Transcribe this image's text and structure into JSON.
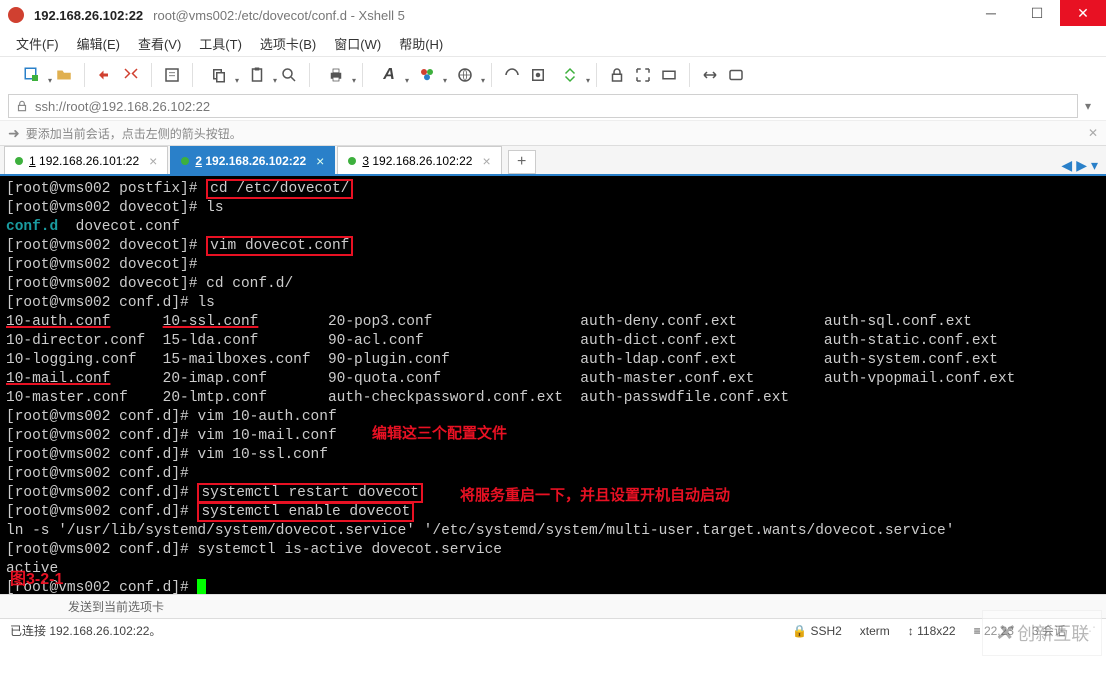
{
  "title": {
    "ip": "192.168.26.102:22",
    "path": "root@vms002:/etc/dovecot/conf.d - Xshell 5"
  },
  "menu": {
    "file": "文件(F)",
    "edit": "编辑(E)",
    "view": "查看(V)",
    "tools": "工具(T)",
    "tabs": "选项卡(B)",
    "window": "窗口(W)",
    "help": "帮助(H)"
  },
  "address": "ssh://root@192.168.26.102:22",
  "hint": "要添加当前会话，点击左侧的箭头按钮。",
  "tabs": [
    {
      "index": "1",
      "label": "192.168.26.101:22"
    },
    {
      "index": "2",
      "label": "192.168.26.102:22"
    },
    {
      "index": "3",
      "label": "192.168.26.102:22"
    }
  ],
  "active_tab": 1,
  "term": {
    "prompt_postfix": "[root@vms002 postfix]# ",
    "prompt_dovecot": "[root@vms002 dovecot]# ",
    "prompt_confd": "[root@vms002 conf.d]# ",
    "cmd_cd": "cd /etc/dovecot/",
    "cmd_ls": "ls",
    "ls1_confd": "conf.d",
    "ls1_file": "  dovecot.conf",
    "cmd_vim_dove": "vim dovecot.conf",
    "cmd_cd_confd": "cd conf.d/",
    "files_col1": [
      "10-auth.conf",
      "10-director.conf",
      "10-logging.conf",
      "10-mail.conf",
      "10-master.conf"
    ],
    "files_col2": [
      "10-ssl.conf",
      "15-lda.conf",
      "15-mailboxes.conf",
      "20-imap.conf",
      "20-lmtp.conf"
    ],
    "files_col3": [
      "20-pop3.conf",
      "90-acl.conf",
      "90-plugin.conf",
      "90-quota.conf",
      "auth-checkpassword.conf.ext"
    ],
    "files_col4": [
      "auth-deny.conf.ext",
      "auth-dict.conf.ext",
      "auth-ldap.conf.ext",
      "auth-master.conf.ext",
      "auth-passwdfile.conf.ext"
    ],
    "files_col5": [
      "auth-sql.conf.ext",
      "auth-static.conf.ext",
      "auth-system.conf.ext",
      "auth-vpopmail.conf.ext",
      ""
    ],
    "cmd_vim_auth": "vim 10-auth.conf",
    "cmd_vim_mail": "vim 10-mail.conf",
    "cmd_vim_ssl": "vim 10-ssl.conf",
    "cmd_restart": "systemctl restart dovecot",
    "cmd_enable": "systemctl enable dovecot",
    "ln_output": "ln -s '/usr/lib/systemd/system/dovecot.service' '/etc/systemd/system/multi-user.target.wants/dovecot.service'",
    "cmd_isactive": "systemctl is-active dovecot.service",
    "active": "active",
    "anno1": "编辑这三个配置文件",
    "anno2": "将服务重启一下，并且设置开机自动启动",
    "fig": "图3-2-1"
  },
  "bottomhint": "发送到当前选项卡",
  "status": {
    "conn": "已连接 192.168.26.102:22。",
    "ssh": "SSH2",
    "term": "xterm",
    "size": "118x22",
    "pos": "22,23",
    "sess": "3 会话"
  },
  "watermark": "创新互联"
}
